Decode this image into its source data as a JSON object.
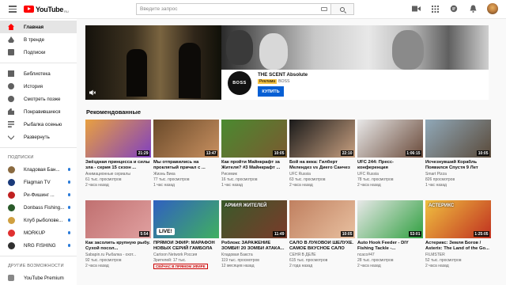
{
  "header": {
    "logo_text": "YouTube",
    "logo_region": "RU",
    "search_placeholder": "Введите запрос"
  },
  "sidebar": {
    "items": [
      {
        "label": "Главная",
        "active": true
      },
      {
        "label": "В тренде"
      },
      {
        "label": "Подписки"
      }
    ],
    "library_items": [
      {
        "label": "Библиотека"
      },
      {
        "label": "История"
      },
      {
        "label": "Смотреть позже"
      },
      {
        "label": "Понравившиеся"
      },
      {
        "label": "Рыбалка осенью"
      },
      {
        "label": "Развернуть"
      }
    ],
    "subscriptions_heading": "ПОДПИСКИ",
    "channels": [
      {
        "label": "Кладовая Бан...",
        "color": "#8a6a40",
        "dot": true
      },
      {
        "label": "Flagman TV",
        "color": "#1a3a7a",
        "dot": true
      },
      {
        "label": "Ри-Фишинг ...",
        "color": "#c02020",
        "dot": true
      },
      {
        "label": "Donbass Fishing...",
        "color": "#2a5a2a",
        "dot": true
      },
      {
        "label": "Клуб рыболове...",
        "color": "#d0a040",
        "dot": true
      },
      {
        "label": "MORKUP",
        "color": "#e03030",
        "dot": true
      },
      {
        "label": "NRG FISHING",
        "color": "#303030",
        "dot": true
      }
    ],
    "more_heading": "ДРУГИЕ ВОЗМОЖНОСТИ",
    "more_items": [
      {
        "label": "YouTube Premium"
      }
    ]
  },
  "ad": {
    "title": "THE SCENT Absolute",
    "badge": "Реклама",
    "brand": "BOSS",
    "logo_text": "BOSS",
    "button_label": "КУПИТЬ"
  },
  "recommended_title": "Рекомендованные",
  "videos": [
    {
      "title": "Звёздная принцесса и силы зла - серия 15 сезон ...",
      "channel": "Анимационные сериалы",
      "views": "61 тыс. просмотров",
      "age": "2 часа назад",
      "duration": "21:29",
      "colors": [
        "#e8a040",
        "#8040c0"
      ]
    },
    {
      "title": "Мы отправились на проклятый причал с ...",
      "channel": "Жизнь Вика",
      "views": "77 тыс. просмотров",
      "age": "1 час назад",
      "duration": "13:47",
      "colors": [
        "#6a4a2a",
        "#c89060"
      ]
    },
    {
      "title": "Как пройти Майнкрафт за Жителя? #3 Майнкрафт ...",
      "channel": "Рисемик",
      "views": "16 тыс. просмотров",
      "age": "1 час назад",
      "duration": "10:05",
      "colors": [
        "#4a8a30",
        "#7a5a30"
      ]
    },
    {
      "title": "Бой на века: Гилберт Мелендез vs Диего Санчез",
      "channel": "UFC Russia",
      "views": "63 тыс. просмотров",
      "age": "2 часа назад",
      "duration": "22:10",
      "colors": [
        "#1a1a1a",
        "#c8a080"
      ]
    },
    {
      "title": "UFC 244: Пресс-конференция",
      "channel": "UFC Russia",
      "views": "78 тыс. просмотров",
      "age": "2 часа назад",
      "duration": "1:06:15",
      "colors": [
        "#e8e8e8",
        "#6a4a3a"
      ]
    },
    {
      "title": "Исчезнувший Корабль Появился Спустя 9 Лет",
      "channel": "Smart Pizza",
      "views": "826 просмотров",
      "age": "1 час назад",
      "duration": "10:05",
      "colors": [
        "#90a8b8",
        "#5a4a3a"
      ]
    },
    {
      "title": "Как засолить крупную рыбу. Сухой посол...",
      "channel": "Sabapin.ru Рыбалка - охот...",
      "views": "92 тыс. просмотров",
      "age": "2 часа назад",
      "duration": "5:54",
      "colors": [
        "#c07070",
        "#e0a0a0"
      ]
    },
    {
      "title": "ПРЯМОЙ ЭФИР: МАРАФОН НОВЫХ СЕРИЙ ГАМБОЛА",
      "channel": "Cartoon Network Россия",
      "views": "Зрителей: 17 тыс.",
      "age": "",
      "live_badge": "СЕЙЧАС В ПРЯМОМ ЭФИРЕ",
      "duration": "",
      "live_overlay": "LIVE!",
      "colors": [
        "#3060c0",
        "#40b060"
      ]
    },
    {
      "title": "Роблокс ЗАРАЖЕНИЕ ЗОМБИ! 20 ЗОМБИ АТАКА...",
      "channel": "Кладовая Бакста",
      "views": "119 тыс. просмотров",
      "age": "12 месяцев назад",
      "duration": "11:49",
      "overlay": "АРМИЯ ЖИТЕЛЕЙ",
      "colors": [
        "#3a5a2a",
        "#7a3a2a"
      ]
    },
    {
      "title": "САЛО В ЛУКОВОЙ ШЕЛУХЕ. САМОЕ ВКУСНОЕ САЛО",
      "channel": "СЕНЯ В ДЕЛЕ",
      "views": "615 тыс. просмотров",
      "age": "2 года назад",
      "duration": "10:05",
      "colors": [
        "#c08060",
        "#e8c0a0"
      ]
    },
    {
      "title": "Auto Hook Feeder - DIY Fishing Tackle -...",
      "channel": "ncaco#47",
      "views": "28 тыс. просмотров",
      "age": "2 часа назад",
      "duration": "53:01",
      "colors": [
        "#e8e8e8",
        "#30a040"
      ]
    },
    {
      "title": "Астерикс: Земля Богов / Asterix: The Land of the Go...",
      "channel": "FILMSTER",
      "views": "52 тыс. просмотров",
      "age": "2 часа назад",
      "duration": "1:25:05",
      "overlay": "АСТЕРИКС",
      "colors": [
        "#f0c040",
        "#c03020"
      ]
    }
  ]
}
